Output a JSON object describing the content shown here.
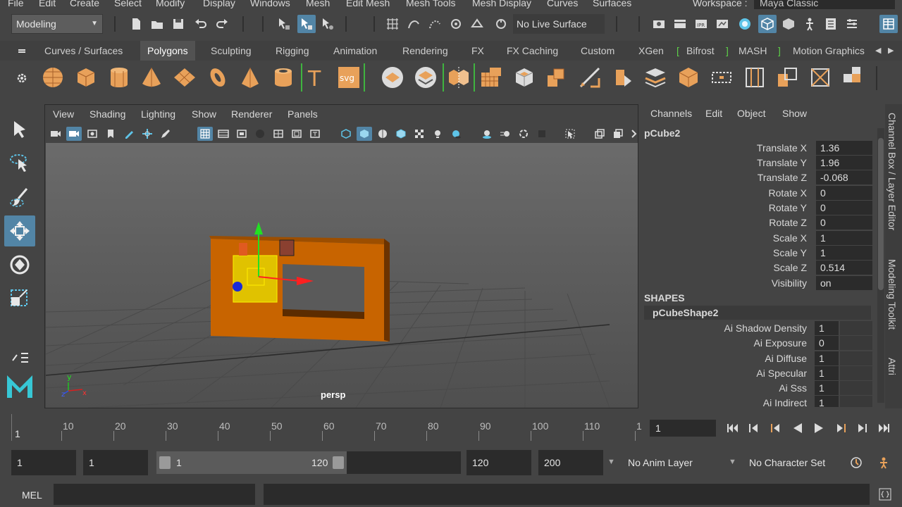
{
  "menubar": {
    "items": [
      "File",
      "Edit",
      "Create",
      "Select",
      "Modify",
      "Display",
      "Windows",
      "Mesh",
      "Edit Mesh",
      "Mesh Tools",
      "Mesh Display",
      "Curves",
      "Surfaces"
    ],
    "workspace_label": "Workspace :",
    "workspace_value": "Maya Classic"
  },
  "statusline": {
    "mode": "Modeling",
    "live_surface": "No Live Surface"
  },
  "shelf": {
    "tabs": [
      "Curves / Surfaces",
      "Polygons",
      "Sculpting",
      "Rigging",
      "Animation",
      "Rendering",
      "FX",
      "FX Caching",
      "Custom",
      "XGen",
      "Bifrost",
      "MASH",
      "Motion Graphics"
    ],
    "active_tab": "Polygons",
    "bracket_open": "[",
    "bracket_close": "]",
    "text_tool_glyph": "T",
    "svg_tool_label": "svg"
  },
  "viewport": {
    "menu": [
      "View",
      "Shading",
      "Lighting",
      "Show",
      "Renderer",
      "Panels"
    ],
    "camera": "persp",
    "axis_y": "y",
    "axis_z": "z",
    "axis_x": "x"
  },
  "channelbox": {
    "menu": [
      "Channels",
      "Edit",
      "Object",
      "Show"
    ],
    "object": "pCube2",
    "attributes": [
      {
        "label": "Translate X",
        "value": "1.36"
      },
      {
        "label": "Translate Y",
        "value": "1.96"
      },
      {
        "label": "Translate Z",
        "value": "-0.068"
      },
      {
        "label": "Rotate X",
        "value": "0"
      },
      {
        "label": "Rotate Y",
        "value": "0"
      },
      {
        "label": "Rotate Z",
        "value": "0"
      },
      {
        "label": "Scale X",
        "value": "1"
      },
      {
        "label": "Scale Y",
        "value": "1"
      },
      {
        "label": "Scale Z",
        "value": "0.514"
      },
      {
        "label": "Visibility",
        "value": "on"
      }
    ],
    "shapes_header": "SHAPES",
    "shape_name": "pCubeShape2",
    "shape_attributes": [
      {
        "label": "Ai Shadow Density",
        "value": "1"
      },
      {
        "label": "Ai Exposure",
        "value": "0"
      },
      {
        "label": "Ai Diffuse",
        "value": "1"
      },
      {
        "label": "Ai Specular",
        "value": "1"
      },
      {
        "label": "Ai Sss",
        "value": "1"
      },
      {
        "label": "Ai Indirect",
        "value": "1"
      }
    ]
  },
  "side_tabs": [
    "Channel Box / Layer Editor",
    "Modeling Toolkit",
    "Attri"
  ],
  "timeslider": {
    "ticks": [
      "10",
      "20",
      "30",
      "40",
      "50",
      "60",
      "70",
      "80",
      "90",
      "100",
      "110",
      "1"
    ],
    "current_marker": "1",
    "current_frame": "1"
  },
  "range": {
    "start": "1",
    "playback_start": "1",
    "slider_start": "1",
    "slider_end": "120",
    "playback_end": "120",
    "end": "200",
    "anim_layer": "No Anim Layer",
    "character_set": "No Character Set"
  },
  "cmdline": {
    "label": "MEL"
  },
  "colors": {
    "accent": "#5285a6",
    "panel": "#444444",
    "field": "#2b2b2b",
    "shelf_orange": "#e8a15a",
    "cube_orange": "#c86400"
  }
}
